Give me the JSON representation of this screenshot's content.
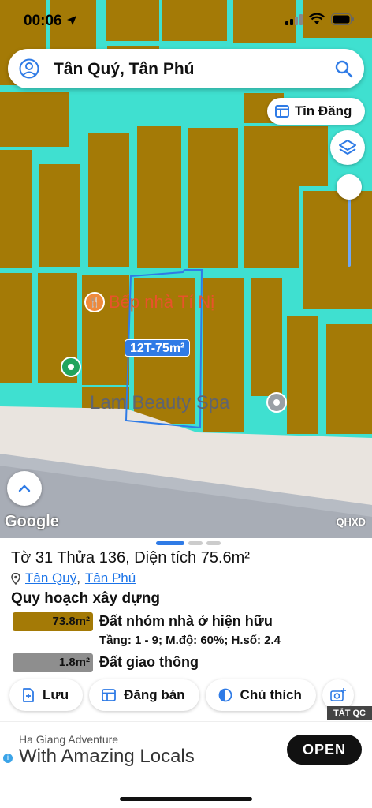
{
  "status": {
    "time": "00:06"
  },
  "search": {
    "text": "Tân Quý, Tân Phú"
  },
  "map": {
    "tin_dang_label": "Tin Đăng",
    "poi_restaurant": "Bếp nhà Tí Nị",
    "poi_spa": "Lam Beauty Spa",
    "lot_label": "12T-75m²",
    "google_text": "Google",
    "qhxd_text": "QHXD",
    "colors": {
      "parcel": "#a47a06",
      "boundary": "#3fe0d0",
      "road": "#e9e4df",
      "highway": "#b7bcc4"
    }
  },
  "sheet": {
    "title": "Tờ 31 Thửa 136, Diện tích 75.6m²",
    "location_ward": "Tân Quý",
    "location_sep": ",",
    "location_district": "Tân Phú",
    "section_title": "Quy hoạch xây dựng",
    "zones": [
      {
        "area": "73.8m²",
        "name": "Đất nhóm nhà ở hiện hữu",
        "detail": "Tầng: 1 - 9; M.độ: 60%; H.số: 2.4",
        "color": "#a47a06"
      },
      {
        "area": "1.8m²",
        "name": "Đất giao thông",
        "color": "#8e8e8e"
      }
    ],
    "actions": {
      "save": "Lưu",
      "post_sale": "Đăng bán",
      "legend": "Chú thích"
    }
  },
  "ad": {
    "tag": "TẮT QC",
    "sub": "Ha Giang Adventure",
    "headline": "With Amazing Locals",
    "button": "OPEN"
  }
}
